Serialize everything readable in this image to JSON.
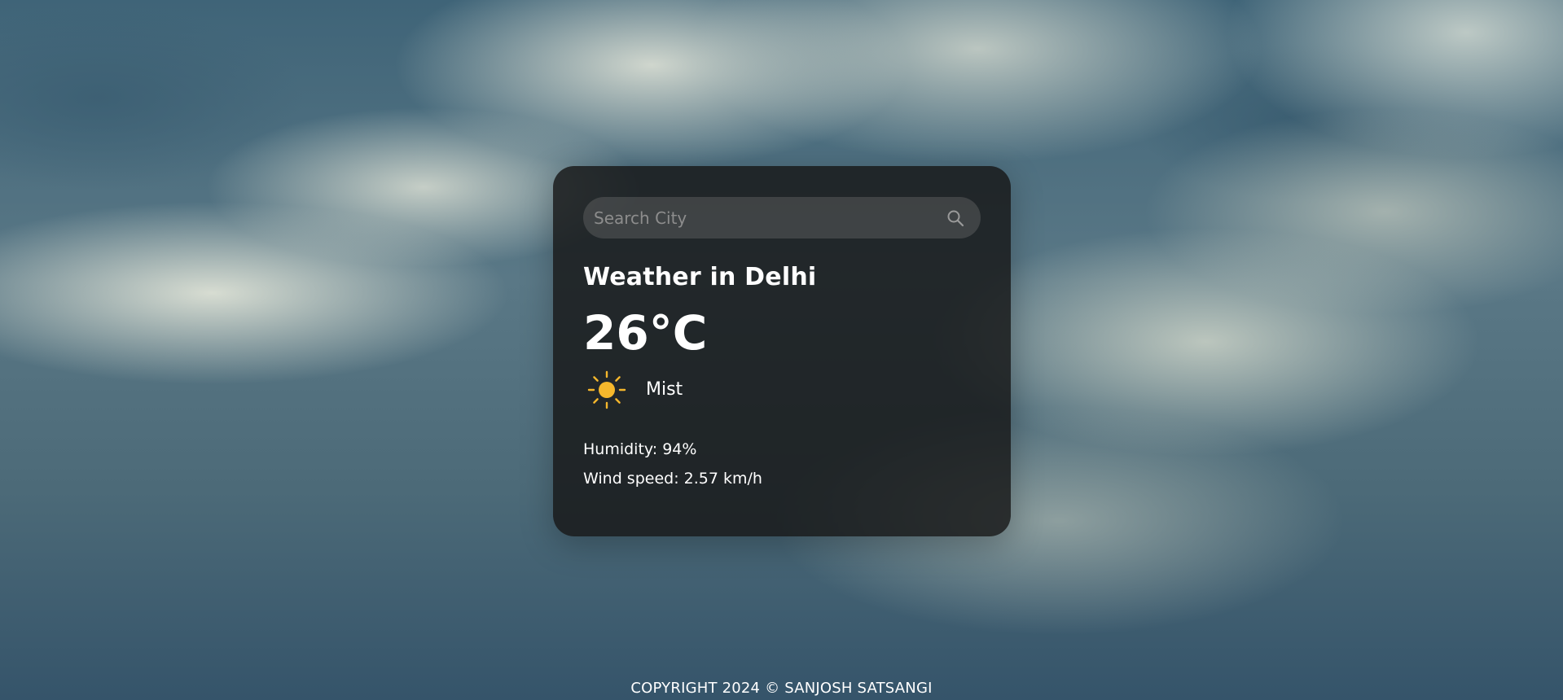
{
  "search": {
    "placeholder": "Search City",
    "value": ""
  },
  "weather": {
    "title": "Weather in Delhi",
    "temperature": "26°C",
    "condition": "Mist",
    "condition_icon": "sun-icon",
    "humidity": "Humidity: 94%",
    "wind": "Wind speed: 2.57 km/h"
  },
  "footer": {
    "text": "COPYRIGHT 2024 © SANJOSH SATSANGI"
  },
  "colors": {
    "card_background": "#161616",
    "text": "#ffffff",
    "sun": "#f5b72c"
  }
}
